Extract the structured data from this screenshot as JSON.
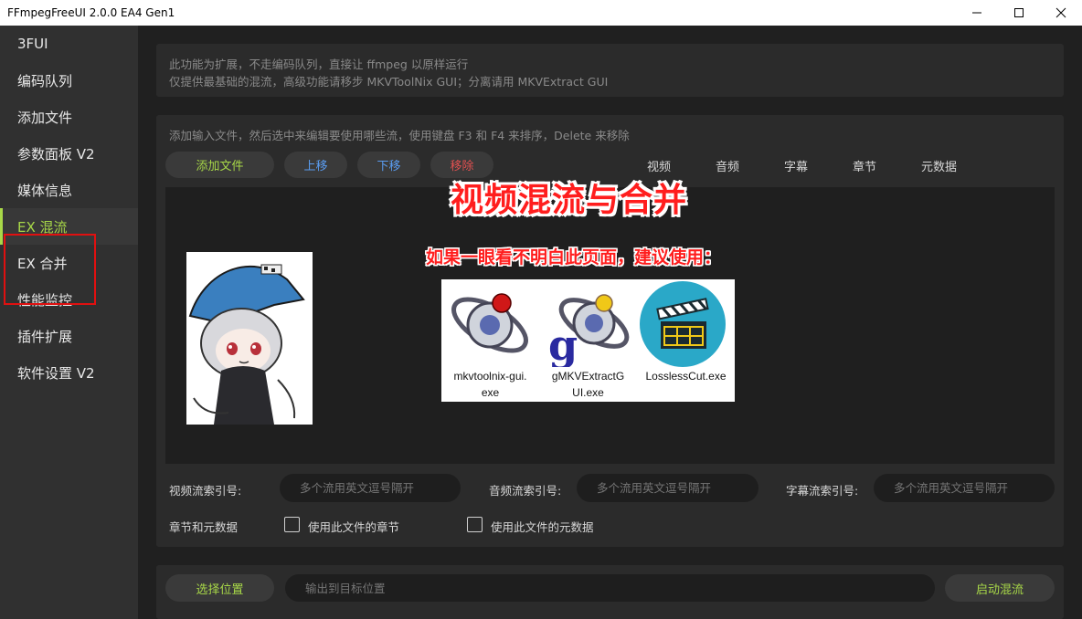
{
  "window": {
    "title": "FFmpegFreeUI 2.0.0 EA4 Gen1"
  },
  "sidebar": {
    "items": [
      {
        "label": "3FUI"
      },
      {
        "label": "编码队列"
      },
      {
        "label": "添加文件"
      },
      {
        "label": "参数面板 V2"
      },
      {
        "label": "媒体信息"
      },
      {
        "label": "EX 混流",
        "active": true
      },
      {
        "label": "EX 合并"
      },
      {
        "label": "性能监控"
      },
      {
        "label": "插件扩展"
      },
      {
        "label": "软件设置 V2"
      }
    ]
  },
  "info": {
    "line1": "此功能为扩展，不走编码队列，直接让 ffmpeg 以原样运行",
    "line2": "仅提供最基础的混流，高级功能请移步 MKVToolNix GUI；分离请用 MKVExtract GUI"
  },
  "mux": {
    "hint": "添加输入文件，然后选中来编辑要使用哪些流，使用键盘 F3 和 F4 来排序，Delete 来移除",
    "buttons": {
      "add": "添加文件",
      "up": "上移",
      "down": "下移",
      "remove": "移除"
    },
    "stream_tabs": [
      "视频",
      "音频",
      "字幕",
      "章节",
      "元数据"
    ],
    "fields": {
      "video_label": "视频流索引号:",
      "audio_label": "音频流索引号:",
      "subtitle_label": "字幕流索引号:",
      "placeholder": "多个流用英文逗号隔开",
      "chapters_meta_label": "章节和元数据",
      "use_chapters": "使用此文件的章节",
      "use_metadata": "使用此文件的元数据"
    }
  },
  "output": {
    "choose_button": "选择位置",
    "placeholder": "输出到目标位置",
    "start_button": "启动混流"
  },
  "overlay": {
    "title": "视频混流与合并",
    "subtitle": "如果一眼看不明白此页面，建议使用：",
    "tools": [
      {
        "line1": "mkvtoolnix-gui.",
        "line2": "exe"
      },
      {
        "line1": "gMKVExtractG",
        "line2": "UI.exe"
      },
      {
        "line1": "LosslessCut.exe",
        "line2": ""
      }
    ]
  },
  "colors": {
    "accent_green": "#a8d848",
    "accent_blue": "#5a9cf0",
    "accent_red": "#e05050",
    "overlay_red": "#ff1e1e"
  }
}
